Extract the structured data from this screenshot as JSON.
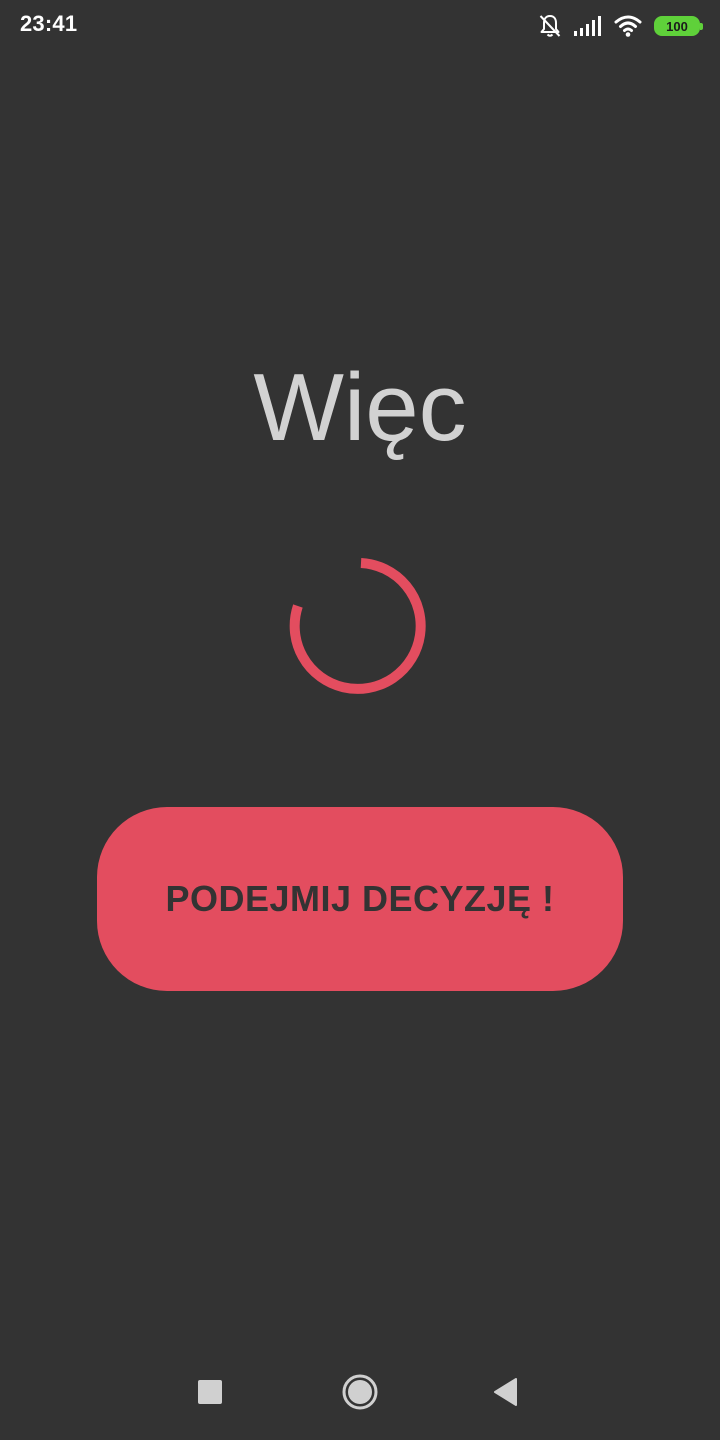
{
  "status_bar": {
    "time": "23:41",
    "icons": [
      "notifications-off-icon",
      "signal-icon",
      "wifi-icon",
      "battery-icon"
    ],
    "battery_level": "100",
    "battery_color": "#5fd13a"
  },
  "main": {
    "headline": "Więc",
    "spinner": {
      "icon": "loading-spinner-icon",
      "color": "#e34d5f"
    },
    "decide_button": {
      "label": "PODEJMIJ DECYZJĘ !",
      "color": "#e34d5f"
    }
  },
  "nav_bar": {
    "buttons": [
      "recent-apps",
      "home",
      "back"
    ]
  },
  "colors": {
    "background": "#333333",
    "accent": "#e34d5f",
    "headline_text": "#d2d2d2"
  }
}
